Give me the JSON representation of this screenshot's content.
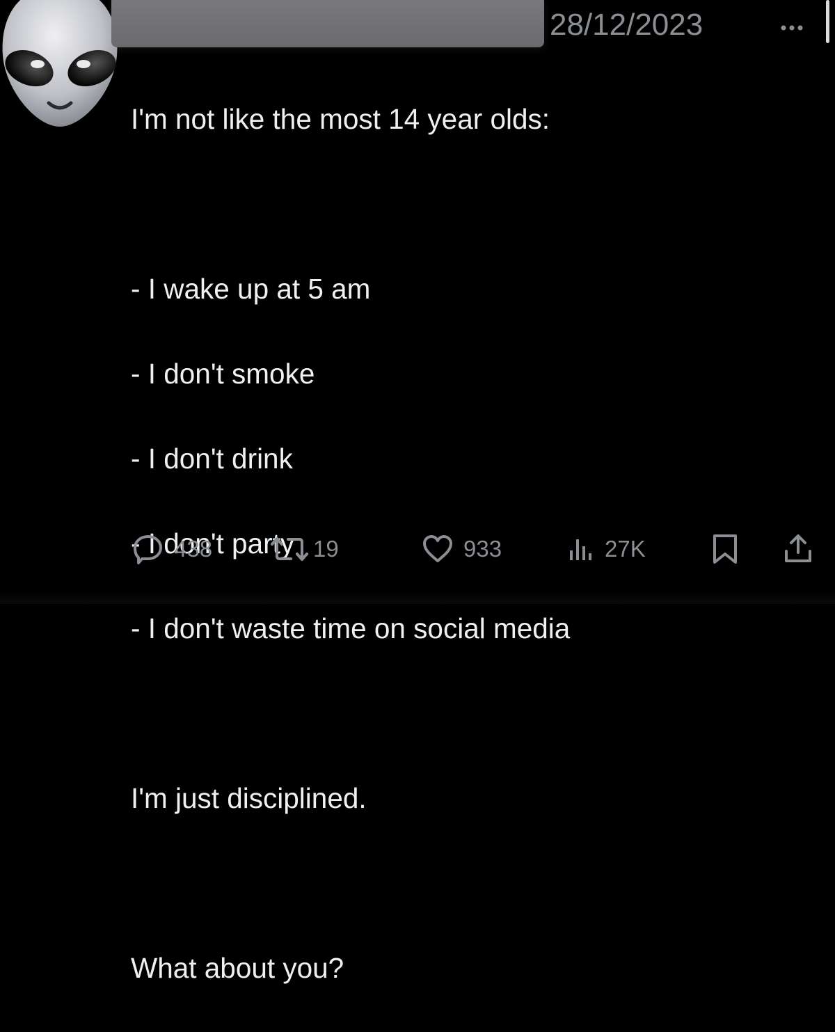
{
  "post": {
    "timestamp": "28/12/2023",
    "body_lines": [
      "I'm not like the most 14 year olds:",
      "",
      "- I wake up at 5 am",
      "- I don't smoke",
      "- I don't drink",
      "- I don't party",
      "- I don't waste time on social media",
      "",
      "I'm just disciplined.",
      "",
      "What about you?"
    ]
  },
  "actions": {
    "replies": "438",
    "reposts": "19",
    "likes": "933",
    "views": "27K"
  },
  "icons": {
    "avatar": "alien-emoji",
    "more": "more-dots-icon",
    "reply": "reply-icon",
    "repost": "repost-icon",
    "like": "heart-icon",
    "views": "views-chart-icon",
    "bookmark": "bookmark-icon",
    "share": "share-icon"
  },
  "colors": {
    "background": "#000000",
    "text": "#e7e9ea",
    "muted": "#8b8f94",
    "redaction": "#727276"
  }
}
